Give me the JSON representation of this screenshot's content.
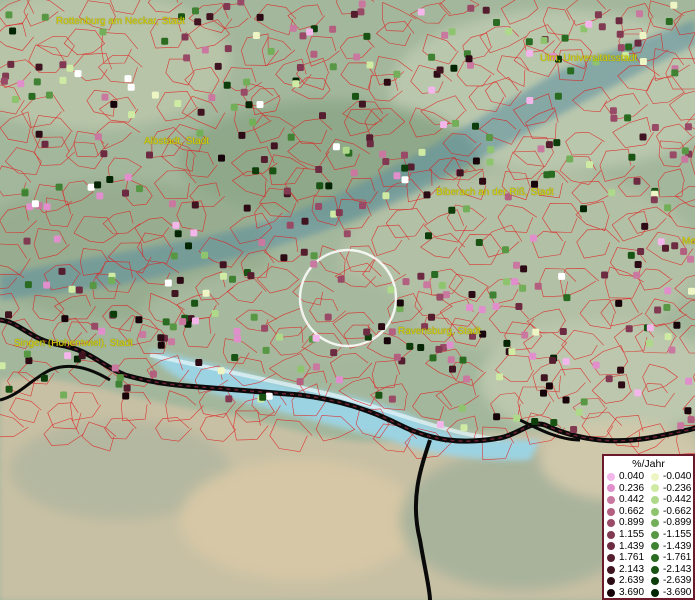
{
  "cities": [
    {
      "id": "rottenburg",
      "name": "Rottenburg am Neckar, Stadt"
    },
    {
      "id": "ulm",
      "name": "Ulm, Universitätsstadt"
    },
    {
      "id": "albstadt",
      "name": "Albstadt, Stadt"
    },
    {
      "id": "biberach",
      "name": "Biberach an der Riß, Stadt"
    },
    {
      "id": "singen",
      "name": "Singen (Hohentwiel), Stadt"
    },
    {
      "id": "ravensburg",
      "name": "Ravensburg, Stadt"
    },
    {
      "id": "edge",
      "name": "Me"
    }
  ],
  "legend": {
    "title": "%/Jahr",
    "positive": [
      {
        "label": "0.040",
        "color": "#f3b6ea"
      },
      {
        "label": "0.236",
        "color": "#e08fcc"
      },
      {
        "label": "0.442",
        "color": "#c9789f"
      },
      {
        "label": "0.662",
        "color": "#b35f7f"
      },
      {
        "label": "0.899",
        "color": "#994a66"
      },
      {
        "label": "1.155",
        "color": "#823a52"
      },
      {
        "label": "1.439",
        "color": "#6c2b40"
      },
      {
        "label": "1.761",
        "color": "#551e2f"
      },
      {
        "label": "2.143",
        "color": "#401421"
      },
      {
        "label": "2.639",
        "color": "#2c0b14"
      },
      {
        "label": "3.690",
        "color": "#17040a"
      }
    ],
    "negative": [
      {
        "label": "-0.040",
        "color": "#eef5c4"
      },
      {
        "label": "-0.236",
        "color": "#cfeaa3"
      },
      {
        "label": "-0.442",
        "color": "#aed98a"
      },
      {
        "label": "-0.662",
        "color": "#8fc46e"
      },
      {
        "label": "-0.899",
        "color": "#73ae58"
      },
      {
        "label": "-1.155",
        "color": "#589845"
      },
      {
        "label": "-1.439",
        "color": "#3f8233"
      },
      {
        "label": "-1.761",
        "color": "#2a6b22"
      },
      {
        "label": "-2.143",
        "color": "#195414"
      },
      {
        "label": "-2.639",
        "color": "#0c3d0a"
      },
      {
        "label": "-3.690",
        "color": "#042503"
      }
    ]
  }
}
